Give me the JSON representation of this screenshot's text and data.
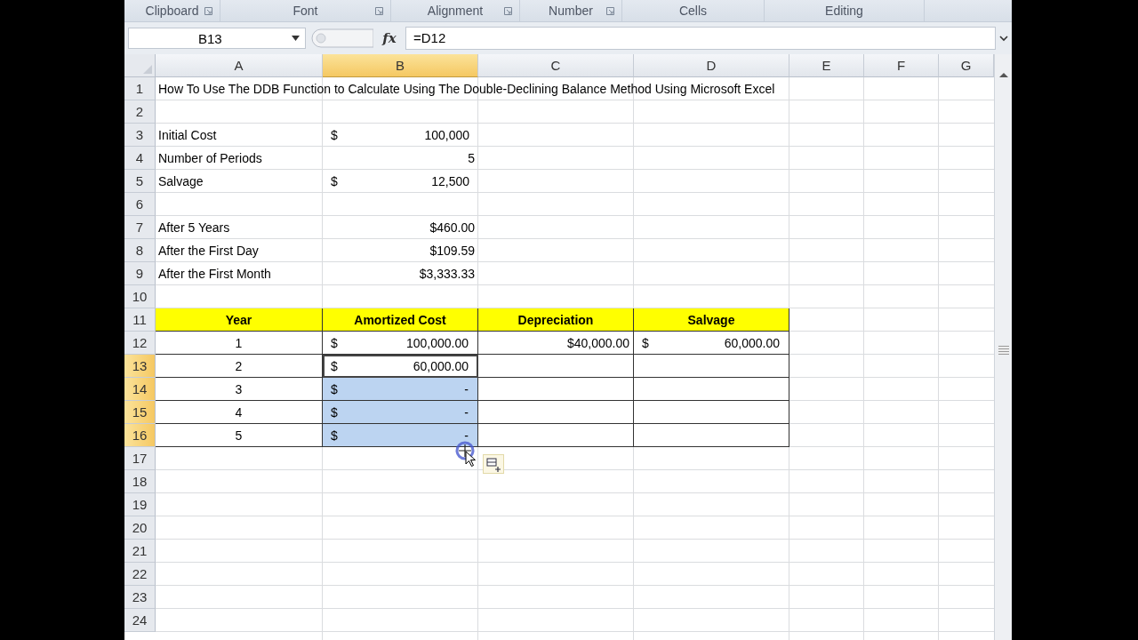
{
  "ribbon_groups": [
    {
      "label": "Clipboard",
      "launcher": true
    },
    {
      "label": "Font",
      "launcher": true
    },
    {
      "label": "Alignment",
      "launcher": true
    },
    {
      "label": "Number",
      "launcher": true
    },
    {
      "label": "Cells",
      "launcher": false
    },
    {
      "label": "Editing",
      "launcher": false
    }
  ],
  "formula_bar": {
    "name_box": "B13",
    "fx": "fx",
    "formula": "=D12"
  },
  "columns": [
    {
      "label": "A",
      "selected": false
    },
    {
      "label": "B",
      "selected": true
    },
    {
      "label": "C",
      "selected": false
    },
    {
      "label": "D",
      "selected": false
    },
    {
      "label": "E",
      "selected": false
    },
    {
      "label": "F",
      "selected": false
    },
    {
      "label": "G",
      "selected": false
    }
  ],
  "rows": [
    {
      "number": "1",
      "selected": false,
      "cells": {
        "a": {
          "kind": "text",
          "text": "How To Use The DDB Function to Calculate Using The Double-Declining Balance Method Using Microsoft Excel"
        }
      }
    },
    {
      "number": "2",
      "selected": false,
      "cells": {}
    },
    {
      "number": "3",
      "selected": false,
      "cells": {
        "a": {
          "kind": "text",
          "text": "Initial Cost"
        },
        "b": {
          "kind": "currency",
          "symbol": "$",
          "text": "100,000"
        }
      }
    },
    {
      "number": "4",
      "selected": false,
      "cells": {
        "a": {
          "kind": "text",
          "text": "Number of Periods"
        },
        "b": {
          "kind": "number",
          "text": "5"
        }
      }
    },
    {
      "number": "5",
      "selected": false,
      "cells": {
        "a": {
          "kind": "text",
          "text": "Salvage"
        },
        "b": {
          "kind": "currency",
          "symbol": "$",
          "text": "12,500"
        }
      }
    },
    {
      "number": "6",
      "selected": false,
      "cells": {}
    },
    {
      "number": "7",
      "selected": false,
      "cells": {
        "a": {
          "kind": "text",
          "text": "After 5 Years"
        },
        "b": {
          "kind": "number",
          "text": "$460.00"
        }
      }
    },
    {
      "number": "8",
      "selected": false,
      "cells": {
        "a": {
          "kind": "text",
          "text": "After the First Day"
        },
        "b": {
          "kind": "number",
          "text": "$109.59"
        }
      }
    },
    {
      "number": "9",
      "selected": false,
      "cells": {
        "a": {
          "kind": "text",
          "text": "After the First Month"
        },
        "b": {
          "kind": "number",
          "text": "$3,333.33"
        }
      }
    },
    {
      "number": "10",
      "selected": false,
      "cells": {}
    },
    {
      "number": "11",
      "selected": false,
      "cells": {
        "a": {
          "kind": "header",
          "text": "Year"
        },
        "b": {
          "kind": "header",
          "text": "Amortized Cost"
        },
        "c": {
          "kind": "header",
          "text": "Depreciation"
        },
        "d": {
          "kind": "header",
          "text": "Salvage"
        }
      }
    },
    {
      "number": "12",
      "selected": false,
      "cells": {
        "a": {
          "kind": "center",
          "text": "1",
          "bordered": true
        },
        "b": {
          "kind": "currency",
          "symbol": "$",
          "text": "100,000.00",
          "bordered": true
        },
        "c": {
          "kind": "number",
          "text": "$40,000.00",
          "bordered": true
        },
        "d": {
          "kind": "currency",
          "symbol": "$",
          "text": "60,000.00",
          "bordered": true
        }
      }
    },
    {
      "number": "13",
      "selected": true,
      "cells": {
        "a": {
          "kind": "center",
          "text": "2",
          "bordered": true
        },
        "b": {
          "kind": "currency",
          "symbol": "$",
          "text": "60,000.00",
          "bordered": true,
          "selected": true,
          "active": true
        },
        "c": {
          "kind": "blank",
          "bordered": true
        },
        "d": {
          "kind": "blank",
          "bordered": true
        }
      }
    },
    {
      "number": "14",
      "selected": true,
      "cells": {
        "a": {
          "kind": "center",
          "text": "3",
          "bordered": true
        },
        "b": {
          "kind": "currency",
          "symbol": "$",
          "text": "-",
          "bordered": true,
          "selected": true,
          "active": false
        },
        "c": {
          "kind": "blank",
          "bordered": true
        },
        "d": {
          "kind": "blank",
          "bordered": true
        }
      }
    },
    {
      "number": "15",
      "selected": true,
      "cells": {
        "a": {
          "kind": "center",
          "text": "4",
          "bordered": true
        },
        "b": {
          "kind": "currency",
          "symbol": "$",
          "text": "-",
          "bordered": true,
          "selected": true,
          "active": false
        },
        "c": {
          "kind": "blank",
          "bordered": true
        },
        "d": {
          "kind": "blank",
          "bordered": true
        }
      }
    },
    {
      "number": "16",
      "selected": true,
      "cells": {
        "a": {
          "kind": "center",
          "text": "5",
          "bordered": true
        },
        "b": {
          "kind": "currency",
          "symbol": "$",
          "text": "-",
          "bordered": true,
          "selected": true,
          "active": false
        },
        "c": {
          "kind": "blank",
          "bordered": true
        },
        "d": {
          "kind": "blank",
          "bordered": true
        }
      }
    },
    {
      "number": "17",
      "selected": false,
      "cells": {}
    },
    {
      "number": "18",
      "selected": false,
      "cells": {}
    },
    {
      "number": "19",
      "selected": false,
      "cells": {}
    },
    {
      "number": "20",
      "selected": false,
      "cells": {}
    },
    {
      "number": "21",
      "selected": false,
      "cells": {}
    },
    {
      "number": "22",
      "selected": false,
      "cells": {}
    },
    {
      "number": "23",
      "selected": false,
      "cells": {}
    },
    {
      "number": "24",
      "selected": false,
      "cells": {}
    }
  ]
}
